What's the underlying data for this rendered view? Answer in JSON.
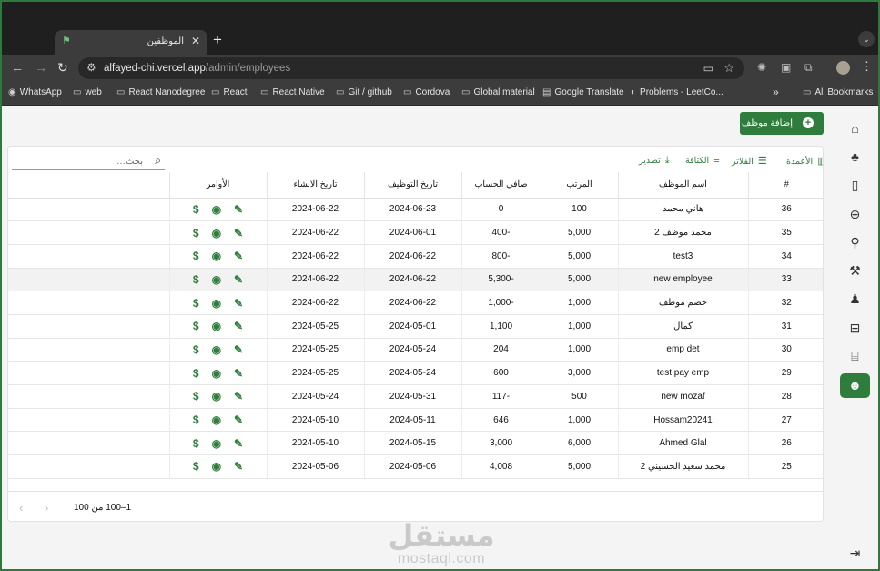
{
  "browser": {
    "tab_title": "الموظفين",
    "new_tab_symbol": "+",
    "url_host": "alfayed-chi.vercel.app",
    "url_path": "/admin/employees",
    "bookmarks": [
      {
        "label": "WhatsApp",
        "icon": "whatsapp-icon"
      },
      {
        "label": "web",
        "icon": "folder-icon"
      },
      {
        "label": "React Nanodegree",
        "icon": "folder-icon"
      },
      {
        "label": "React",
        "icon": "folder-icon"
      },
      {
        "label": "React Native",
        "icon": "folder-icon"
      },
      {
        "label": "Git / github",
        "icon": "folder-icon"
      },
      {
        "label": "Cordova",
        "icon": "folder-icon"
      },
      {
        "label": "Global material",
        "icon": "folder-icon"
      },
      {
        "label": "Google Translate",
        "icon": "translate-icon"
      },
      {
        "label": "Problems - LeetCo...",
        "icon": "leetcode-icon"
      }
    ],
    "more_bookmarks_symbol": "»",
    "all_bookmarks": "All Bookmarks"
  },
  "page": {
    "add_button": "إضافة موظف",
    "toolbar": {
      "columns": "الأعمدة",
      "filters": "الفلاتر",
      "density": "الكثافة",
      "export": "تصدير"
    },
    "search_placeholder": "بحث…",
    "table": {
      "headers": [
        "#",
        "اسم الموظف",
        "المرتب",
        "صافي الحساب",
        "تاريخ التوظيف",
        "تاريخ الانشاء",
        "الأوامر"
      ],
      "rows": [
        {
          "id": "36",
          "name": "هاني محمد",
          "salary": "100",
          "net": "0",
          "hire": "2024-06-23",
          "created": "2024-06-22"
        },
        {
          "id": "35",
          "name": "محمد موظف 2",
          "salary": "5,000",
          "net": "-400",
          "hire": "2024-06-01",
          "created": "2024-06-22"
        },
        {
          "id": "34",
          "name": "test3",
          "salary": "5,000",
          "net": "-800",
          "hire": "2024-06-22",
          "created": "2024-06-22"
        },
        {
          "id": "33",
          "name": "new employee",
          "salary": "5,000",
          "net": "-5,300",
          "hire": "2024-06-22",
          "created": "2024-06-22"
        },
        {
          "id": "32",
          "name": "خصم موظف",
          "salary": "1,000",
          "net": "-1,000",
          "hire": "2024-06-22",
          "created": "2024-06-22"
        },
        {
          "id": "31",
          "name": "كمال",
          "salary": "1,000",
          "net": "1,100",
          "hire": "2024-05-01",
          "created": "2024-05-25"
        },
        {
          "id": "30",
          "name": "emp det",
          "salary": "1,000",
          "net": "204",
          "hire": "2024-05-24",
          "created": "2024-05-25"
        },
        {
          "id": "29",
          "name": "test pay emp",
          "salary": "3,000",
          "net": "600",
          "hire": "2024-05-24",
          "created": "2024-05-25"
        },
        {
          "id": "28",
          "name": "new mozaf",
          "salary": "500",
          "net": "-117",
          "hire": "2024-05-31",
          "created": "2024-05-24"
        },
        {
          "id": "27",
          "name": "Hossam20241",
          "salary": "1,000",
          "net": "646",
          "hire": "2024-05-11",
          "created": "2024-05-10"
        },
        {
          "id": "26",
          "name": "Ahmed Glal",
          "salary": "6,000",
          "net": "3,000",
          "hire": "2024-05-15",
          "created": "2024-05-10"
        },
        {
          "id": "25",
          "name": "محمد سعيد الحسيني 2",
          "salary": "5,000",
          "net": "4,008",
          "hire": "2024-05-06",
          "created": "2024-05-06"
        }
      ]
    },
    "pagination": "1–100 من 100",
    "watermark": {
      "arabic": "مستقل",
      "latin": "mostaql.com"
    },
    "accent": "#2e7d3c"
  }
}
